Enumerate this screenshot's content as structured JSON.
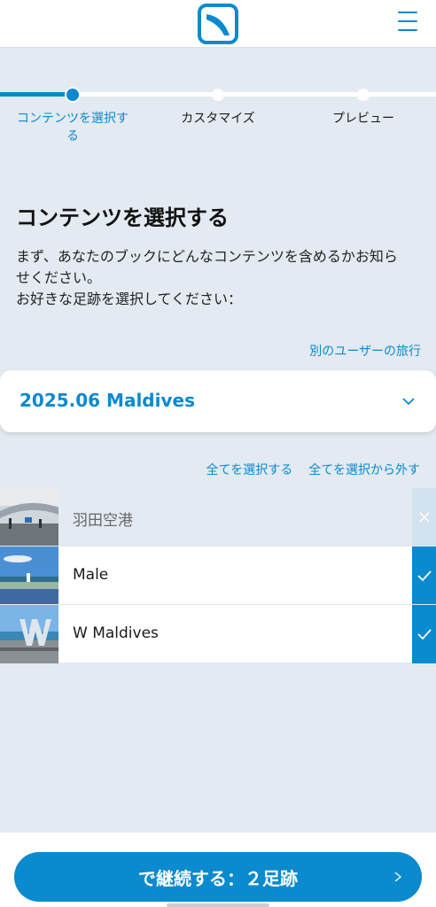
{
  "header": {
    "logo_icon": "bird-logo-icon",
    "menu_icon": "hamburger-menu-icon"
  },
  "stepper": {
    "steps": [
      {
        "label_line1": "コンテンツを選択す",
        "label_line2": "る",
        "active": true
      },
      {
        "label_line1": "カスタマイズ",
        "active": false
      },
      {
        "label_line1": "プレビュー",
        "active": false
      }
    ]
  },
  "main": {
    "title": "コンテンツを選択する",
    "desc_line1": "まず、あなたのブックにどんなコンテンツを含めるかお知ら",
    "desc_line2": "せください。",
    "desc_line3": "お好きな足跡を選択してください：",
    "other_user_link": "別のユーザーの旅行",
    "trip_select": {
      "value": "2025.06 Maldives",
      "icon": "chevron-down-icon"
    },
    "select_all": "全てを選択する",
    "deselect_all": "全てを選択から外す",
    "items": [
      {
        "label": "羽田空港",
        "checked": false
      },
      {
        "label": "Male",
        "checked": true
      },
      {
        "label": "W Maldives",
        "checked": true
      }
    ]
  },
  "footer": {
    "continue_label": "で継続する：２足跡"
  },
  "colors": {
    "accent": "#0a8acf",
    "background": "#e3eaf1"
  }
}
